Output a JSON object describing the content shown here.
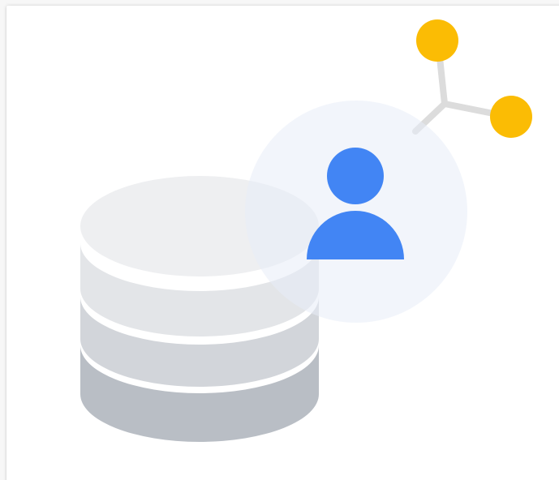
{
  "illustration": {
    "icons": [
      "database-icon",
      "user-icon",
      "network-nodes-icon"
    ]
  },
  "colors": {
    "person_blue": "#4285f4",
    "node_yellow": "#fbbc04",
    "halo": "#eef2fb",
    "connector": "#dcdcdc",
    "db_top": "#eeeff1",
    "db_band_1": "#e3e5e8",
    "db_band_2": "#d2d5da",
    "db_band_3": "#b9bec5"
  }
}
